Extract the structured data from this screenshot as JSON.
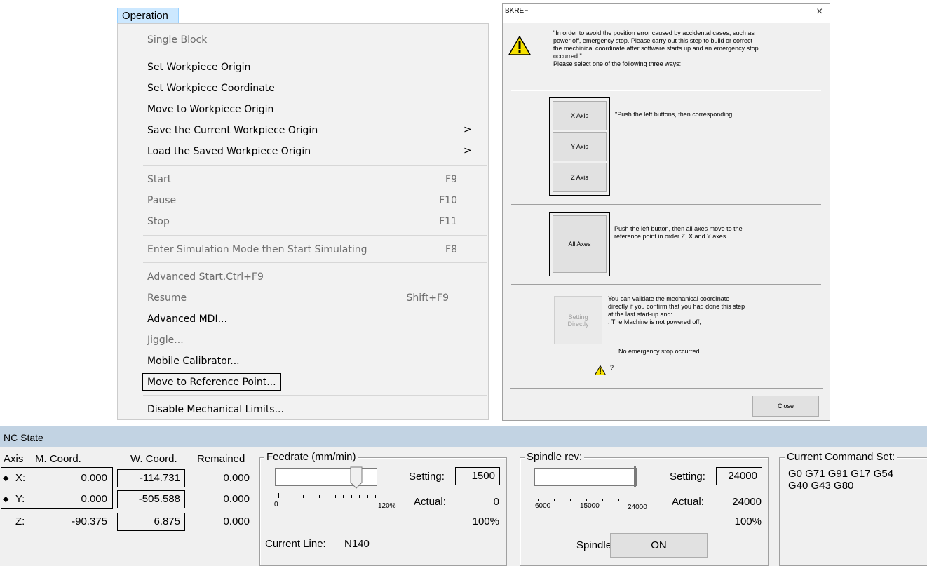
{
  "menu": {
    "title": "Operation",
    "items": [
      {
        "label": "Single Block",
        "shortcut": "",
        "disabled": true,
        "submenu": false
      },
      {
        "label": "Set Workpiece Origin",
        "shortcut": "",
        "disabled": false,
        "submenu": false
      },
      {
        "label": "Set Workpiece Coordinate",
        "shortcut": "",
        "disabled": false,
        "submenu": false
      },
      {
        "label": "Move to Workpiece Origin",
        "shortcut": "",
        "disabled": false,
        "submenu": false
      },
      {
        "label": "Save the Current Workpiece Origin",
        "shortcut": "",
        "disabled": false,
        "submenu": true
      },
      {
        "label": "Load the Saved Workpiece Origin",
        "shortcut": "",
        "disabled": false,
        "submenu": true
      },
      {
        "label": "Start",
        "shortcut": "F9",
        "disabled": true,
        "submenu": false
      },
      {
        "label": "Pause",
        "shortcut": "F10",
        "disabled": true,
        "submenu": false
      },
      {
        "label": "Stop",
        "shortcut": "F11",
        "disabled": true,
        "submenu": false
      },
      {
        "label": "Enter Simulation Mode then Start Simulating",
        "shortcut": "F8",
        "disabled": true,
        "submenu": false
      },
      {
        "label": "Advanced Start.Ctrl+F9",
        "shortcut": "",
        "disabled": true,
        "submenu": false
      },
      {
        "label": "Resume",
        "shortcut": "Shift+F9",
        "disabled": true,
        "submenu": false
      },
      {
        "label": "Advanced MDI...",
        "shortcut": "",
        "disabled": false,
        "submenu": false
      },
      {
        "label": "Jiggle...",
        "shortcut": "",
        "disabled": true,
        "submenu": false
      },
      {
        "label": "Mobile Calibrator...",
        "shortcut": "",
        "disabled": false,
        "submenu": false
      },
      {
        "label": "Move to Reference Point...",
        "shortcut": "",
        "disabled": false,
        "submenu": false,
        "highlighted": true
      },
      {
        "label": "Disable Mechanical Limits...",
        "shortcut": "",
        "disabled": false,
        "submenu": false
      }
    ],
    "submenu_arrow": ">"
  },
  "dialog": {
    "title": "BKREF",
    "close_glyph": "×",
    "intro_lines": [
      "\"In order to avoid the position error caused by accidental cases, such as",
      "power off, emergency stop. Please carry out this step to build or correct",
      "the mechinical coordinate after software starts up and an emergency stop",
      "occurred.\""
    ],
    "select_text": "Please select one of the following three ways:",
    "axis_buttons": [
      "X Axis",
      "Y Axis",
      "Z Axis"
    ],
    "axis_text": "\"Push the left buttons, then corresponding",
    "all_axes_button": "All Axes",
    "all_axes_lines": [
      "Push the left button, then all axes move to the",
      "reference point in order Z, X and Y axes."
    ],
    "setting_button_lines": [
      "Setting",
      "Directly"
    ],
    "validate_lines": [
      "You can validate the mechanical coordinate",
      "directly if you confirm that you had done this step",
      "at the last start-up and:",
      ". The Machine is not powered off;"
    ],
    "no_estop_line": ". No emergency stop occurred.",
    "question_mark": "?",
    "close_button": "Close"
  },
  "nc_state": {
    "title": "NC State",
    "headers": {
      "axis": "Axis",
      "m_coord": "M. Coord.",
      "w_coord": "W. Coord.",
      "remained": "Remained"
    },
    "axes": [
      {
        "name": "X:",
        "m_coord": "0.000",
        "w_coord": "-114.731",
        "remained": "0.000",
        "marker": "◆"
      },
      {
        "name": "Y:",
        "m_coord": "0.000",
        "w_coord": "-505.588",
        "remained": "0.000",
        "marker": "◆"
      },
      {
        "name": "Z:",
        "m_coord": "-90.375",
        "w_coord": "6.875",
        "remained": "0.000",
        "marker": ""
      }
    ],
    "feedrate": {
      "label": "Feedrate (mm/min)",
      "setting_label": "Setting:",
      "setting_value": "1500",
      "actual_label": "Actual:",
      "actual_value": "0",
      "percent": "100%",
      "scale_min": "0",
      "scale_max": "120%",
      "slider_level": 100,
      "current_line_label": "Current Line:",
      "current_line_value": "N140"
    },
    "spindle": {
      "label": "Spindle rev:",
      "setting_label": "Setting:",
      "setting_value": "24000",
      "actual_label": "Actual:",
      "actual_value": "24000",
      "percent": "100%",
      "scale": [
        "6000",
        "15000",
        "24000"
      ],
      "spindle_label": "Spindle:",
      "spindle_button": "ON"
    },
    "command_set": {
      "label": "Current Command Set:",
      "lines": [
        "G0 G71 G91 G17 G54",
        "G40 G43 G80"
      ]
    }
  }
}
